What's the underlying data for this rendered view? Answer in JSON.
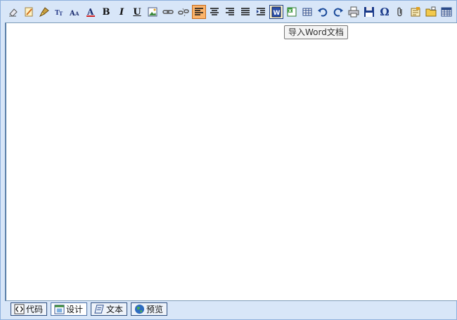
{
  "toolbar": {
    "bold_label": "B",
    "italic_label": "I",
    "underline_label": "U",
    "omega_label": "Ω",
    "items": [
      "eraser-icon",
      "pencil-icon",
      "brush-icon",
      "font-size-icon",
      "font-name-icon",
      "font-color-icon",
      "bold-icon",
      "italic-icon",
      "underline-icon",
      "image-icon",
      "link-icon",
      "unlink-icon",
      "align-left-icon",
      "align-center-icon",
      "align-right-icon",
      "justify-icon",
      "indent-icon",
      "import-word-icon",
      "import-excel-icon",
      "table-icon",
      "undo-icon",
      "redo-icon",
      "print-icon",
      "save-icon",
      "special-char-icon",
      "attachment-icon",
      "template-icon",
      "folder-icon",
      "grid-icon"
    ],
    "active_item": "align-left-icon",
    "hover_item": "import-word-icon"
  },
  "tooltip": {
    "text": "导入Word文档"
  },
  "modes": [
    {
      "label": "代码",
      "icon": "code-icon",
      "active": false
    },
    {
      "label": "设计",
      "icon": "design-icon",
      "active": true
    },
    {
      "label": "文本",
      "icon": "text-icon",
      "active": false
    },
    {
      "label": "预览",
      "icon": "globe-icon",
      "active": false
    }
  ],
  "colors": {
    "frame_background": "#D8E6F8",
    "editor_background": "#FFFFFF",
    "active_button": "#FBB36A",
    "border": "#7F9DB9"
  }
}
